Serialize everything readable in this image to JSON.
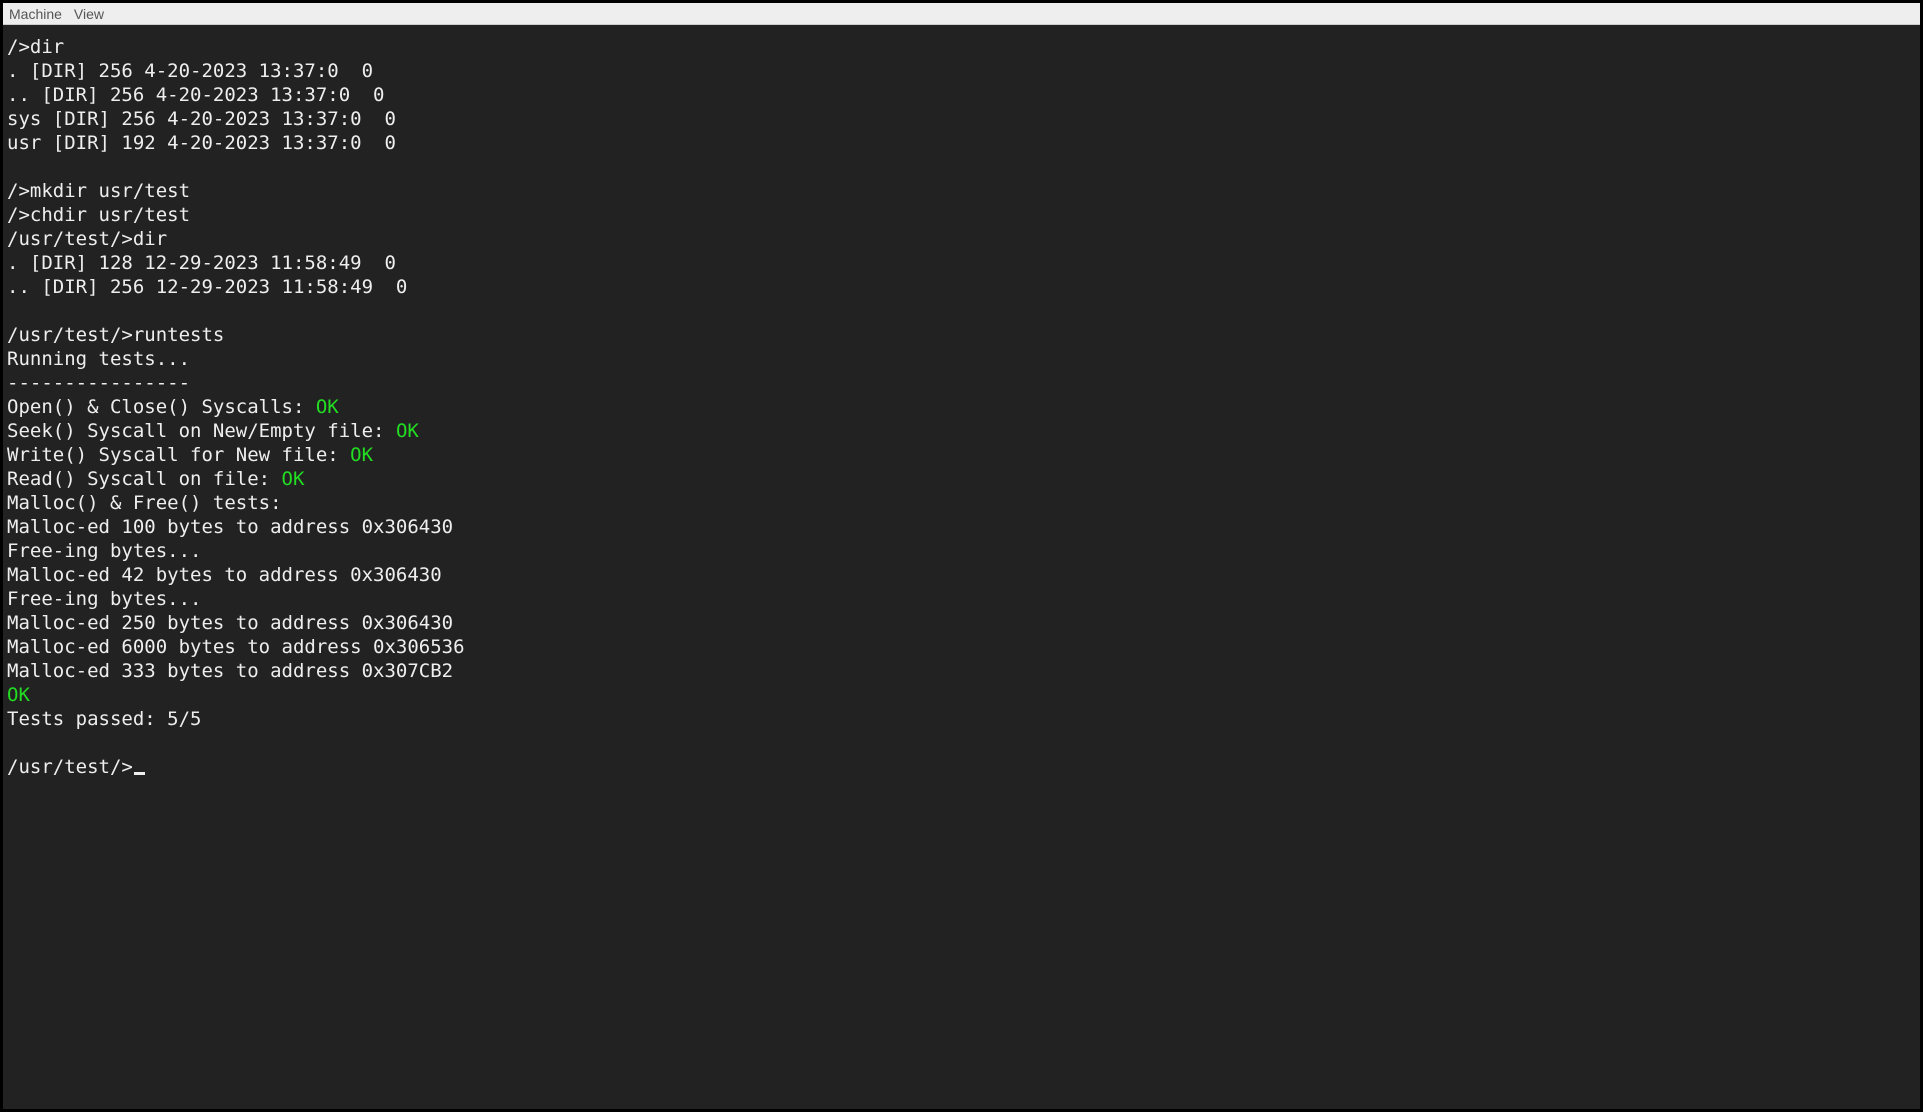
{
  "menubar": {
    "items": [
      "Machine",
      "View"
    ]
  },
  "colors": {
    "terminal_bg": "#222222",
    "terminal_fg": "#eeeeee",
    "ok": "#22dd22",
    "menubar_bg": "#eeeeee",
    "menubar_fg": "#555555"
  },
  "terminal": {
    "lines": [
      {
        "segments": [
          {
            "t": "/>dir"
          }
        ]
      },
      {
        "segments": [
          {
            "t": ". [DIR] 256 4-20-2023 13:37:0  0"
          }
        ]
      },
      {
        "segments": [
          {
            "t": ".. [DIR] 256 4-20-2023 13:37:0  0"
          }
        ]
      },
      {
        "segments": [
          {
            "t": "sys [DIR] 256 4-20-2023 13:37:0  0"
          }
        ]
      },
      {
        "segments": [
          {
            "t": "usr [DIR] 192 4-20-2023 13:37:0  0"
          }
        ]
      },
      {
        "segments": [
          {
            "t": ""
          }
        ]
      },
      {
        "segments": [
          {
            "t": "/>mkdir usr/test"
          }
        ]
      },
      {
        "segments": [
          {
            "t": "/>chdir usr/test"
          }
        ]
      },
      {
        "segments": [
          {
            "t": "/usr/test/>dir"
          }
        ]
      },
      {
        "segments": [
          {
            "t": ". [DIR] 128 12-29-2023 11:58:49  0"
          }
        ]
      },
      {
        "segments": [
          {
            "t": ".. [DIR] 256 12-29-2023 11:58:49  0"
          }
        ]
      },
      {
        "segments": [
          {
            "t": ""
          }
        ]
      },
      {
        "segments": [
          {
            "t": "/usr/test/>runtests"
          }
        ]
      },
      {
        "segments": [
          {
            "t": "Running tests..."
          }
        ]
      },
      {
        "segments": [
          {
            "t": "----------------"
          }
        ]
      },
      {
        "segments": [
          {
            "t": "Open() & Close() Syscalls: "
          },
          {
            "t": "OK",
            "c": "ok"
          }
        ]
      },
      {
        "segments": [
          {
            "t": "Seek() Syscall on New/Empty file: "
          },
          {
            "t": "OK",
            "c": "ok"
          }
        ]
      },
      {
        "segments": [
          {
            "t": "Write() Syscall for New file: "
          },
          {
            "t": "OK",
            "c": "ok"
          }
        ]
      },
      {
        "segments": [
          {
            "t": "Read() Syscall on file: "
          },
          {
            "t": "OK",
            "c": "ok"
          }
        ]
      },
      {
        "segments": [
          {
            "t": "Malloc() & Free() tests:"
          }
        ]
      },
      {
        "segments": [
          {
            "t": "Malloc-ed 100 bytes to address 0x306430"
          }
        ]
      },
      {
        "segments": [
          {
            "t": "Free-ing bytes..."
          }
        ]
      },
      {
        "segments": [
          {
            "t": "Malloc-ed 42 bytes to address 0x306430"
          }
        ]
      },
      {
        "segments": [
          {
            "t": "Free-ing bytes..."
          }
        ]
      },
      {
        "segments": [
          {
            "t": "Malloc-ed 250 bytes to address 0x306430"
          }
        ]
      },
      {
        "segments": [
          {
            "t": "Malloc-ed 6000 bytes to address 0x306536"
          }
        ]
      },
      {
        "segments": [
          {
            "t": "Malloc-ed 333 bytes to address 0x307CB2"
          }
        ]
      },
      {
        "segments": [
          {
            "t": "OK",
            "c": "ok"
          }
        ]
      },
      {
        "segments": [
          {
            "t": "Tests passed: 5/5"
          }
        ]
      },
      {
        "segments": [
          {
            "t": ""
          }
        ]
      },
      {
        "segments": [
          {
            "t": "/usr/test/>"
          }
        ],
        "cursor": true
      }
    ]
  }
}
